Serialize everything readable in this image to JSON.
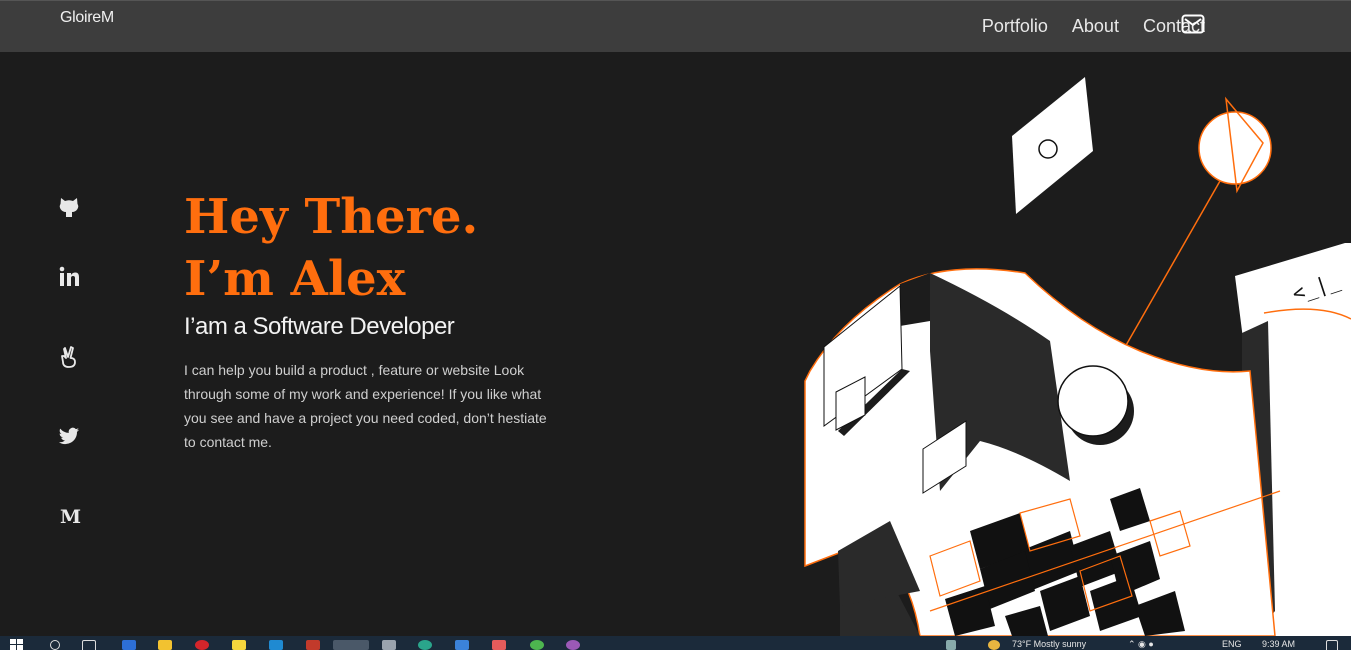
{
  "brand": "GloireM",
  "nav": {
    "portfolio": "Portfolio",
    "about": "About",
    "contact": "Contact"
  },
  "icons": {
    "mail": "mail-icon",
    "social": [
      "github-icon",
      "linkedin-icon",
      "angellist-icon",
      "twitter-icon",
      "medium-icon"
    ]
  },
  "hero": {
    "line1": "Hey There.",
    "line2": "I’m Alex",
    "subtitle": "I’am a Software Developer",
    "description": "I can help you build a product , feature or website Look through some of my work and experience! If you like what you see and have a project you need coded, don’t hestiate to contact me."
  },
  "illustration": {
    "code_glyph": "<_|_"
  },
  "taskbar": {
    "weather": "73°F  Mostly sunny",
    "lang": "ENG",
    "time": "9:39 AM"
  },
  "colors": {
    "accent": "#ff6e0e",
    "background": "#1c1c1c",
    "navbar": "#3d3d3d"
  }
}
